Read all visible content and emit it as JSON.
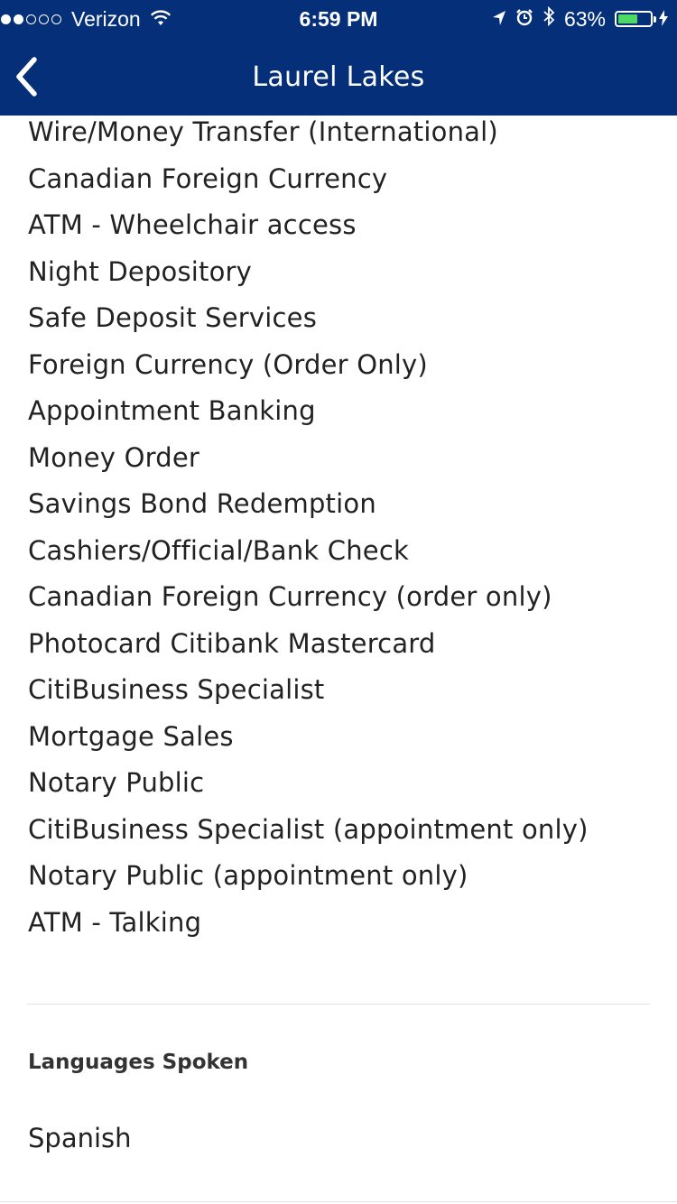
{
  "status_bar": {
    "signal_bars_filled": 2,
    "signal_bars_total": 5,
    "carrier": "Verizon",
    "time": "6:59 PM",
    "battery_percent": "63%",
    "battery_level": 0.63,
    "icons": [
      "wifi-icon",
      "location-arrow-icon",
      "alarm-icon",
      "bluetooth-icon",
      "battery-icon",
      "charging-bolt-icon"
    ],
    "battery_color": "#4cd964"
  },
  "header": {
    "title": "Laurel Lakes",
    "background_color": "#053079",
    "back_icon": "chevron-left-icon"
  },
  "services": [
    "Wire/Money Transfer (International)",
    "Canadian Foreign Currency",
    "ATM - Wheelchair access",
    "Night Depository",
    "Safe Deposit Services",
    "Foreign Currency (Order Only)",
    "Appointment Banking",
    "Money Order",
    "Savings Bond Redemption",
    "Cashiers/Official/Bank Check",
    "Canadian Foreign Currency (order only)",
    "Photocard Citibank Mastercard",
    "CitiBusiness Specialist",
    "Mortgage Sales",
    "Notary Public",
    "CitiBusiness Specialist (appointment only)",
    "Notary Public (appointment only)",
    "ATM - Talking"
  ],
  "languages": {
    "header": "Languages Spoken",
    "items": [
      "Spanish"
    ]
  }
}
